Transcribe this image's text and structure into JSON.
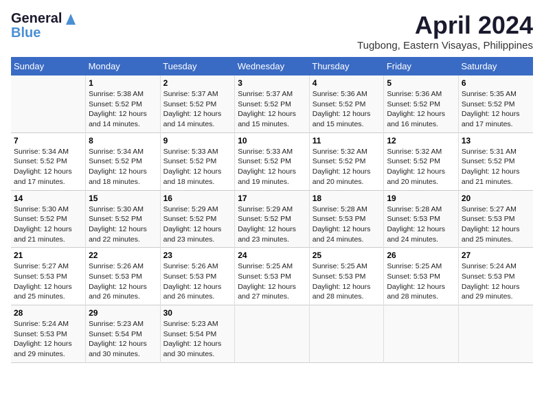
{
  "header": {
    "logo_general": "General",
    "logo_blue": "Blue",
    "month_title": "April 2024",
    "location": "Tugbong, Eastern Visayas, Philippines"
  },
  "days_of_week": [
    "Sunday",
    "Monday",
    "Tuesday",
    "Wednesday",
    "Thursday",
    "Friday",
    "Saturday"
  ],
  "weeks": [
    [
      {
        "day": "",
        "info": ""
      },
      {
        "day": "1",
        "info": "Sunrise: 5:38 AM\nSunset: 5:52 PM\nDaylight: 12 hours and 14 minutes."
      },
      {
        "day": "2",
        "info": "Sunrise: 5:37 AM\nSunset: 5:52 PM\nDaylight: 12 hours and 14 minutes."
      },
      {
        "day": "3",
        "info": "Sunrise: 5:37 AM\nSunset: 5:52 PM\nDaylight: 12 hours and 15 minutes."
      },
      {
        "day": "4",
        "info": "Sunrise: 5:36 AM\nSunset: 5:52 PM\nDaylight: 12 hours and 15 minutes."
      },
      {
        "day": "5",
        "info": "Sunrise: 5:36 AM\nSunset: 5:52 PM\nDaylight: 12 hours and 16 minutes."
      },
      {
        "day": "6",
        "info": "Sunrise: 5:35 AM\nSunset: 5:52 PM\nDaylight: 12 hours and 17 minutes."
      }
    ],
    [
      {
        "day": "7",
        "info": "Sunrise: 5:34 AM\nSunset: 5:52 PM\nDaylight: 12 hours and 17 minutes."
      },
      {
        "day": "8",
        "info": "Sunrise: 5:34 AM\nSunset: 5:52 PM\nDaylight: 12 hours and 18 minutes."
      },
      {
        "day": "9",
        "info": "Sunrise: 5:33 AM\nSunset: 5:52 PM\nDaylight: 12 hours and 18 minutes."
      },
      {
        "day": "10",
        "info": "Sunrise: 5:33 AM\nSunset: 5:52 PM\nDaylight: 12 hours and 19 minutes."
      },
      {
        "day": "11",
        "info": "Sunrise: 5:32 AM\nSunset: 5:52 PM\nDaylight: 12 hours and 20 minutes."
      },
      {
        "day": "12",
        "info": "Sunrise: 5:32 AM\nSunset: 5:52 PM\nDaylight: 12 hours and 20 minutes."
      },
      {
        "day": "13",
        "info": "Sunrise: 5:31 AM\nSunset: 5:52 PM\nDaylight: 12 hours and 21 minutes."
      }
    ],
    [
      {
        "day": "14",
        "info": "Sunrise: 5:30 AM\nSunset: 5:52 PM\nDaylight: 12 hours and 21 minutes."
      },
      {
        "day": "15",
        "info": "Sunrise: 5:30 AM\nSunset: 5:52 PM\nDaylight: 12 hours and 22 minutes."
      },
      {
        "day": "16",
        "info": "Sunrise: 5:29 AM\nSunset: 5:52 PM\nDaylight: 12 hours and 23 minutes."
      },
      {
        "day": "17",
        "info": "Sunrise: 5:29 AM\nSunset: 5:52 PM\nDaylight: 12 hours and 23 minutes."
      },
      {
        "day": "18",
        "info": "Sunrise: 5:28 AM\nSunset: 5:53 PM\nDaylight: 12 hours and 24 minutes."
      },
      {
        "day": "19",
        "info": "Sunrise: 5:28 AM\nSunset: 5:53 PM\nDaylight: 12 hours and 24 minutes."
      },
      {
        "day": "20",
        "info": "Sunrise: 5:27 AM\nSunset: 5:53 PM\nDaylight: 12 hours and 25 minutes."
      }
    ],
    [
      {
        "day": "21",
        "info": "Sunrise: 5:27 AM\nSunset: 5:53 PM\nDaylight: 12 hours and 25 minutes."
      },
      {
        "day": "22",
        "info": "Sunrise: 5:26 AM\nSunset: 5:53 PM\nDaylight: 12 hours and 26 minutes."
      },
      {
        "day": "23",
        "info": "Sunrise: 5:26 AM\nSunset: 5:53 PM\nDaylight: 12 hours and 26 minutes."
      },
      {
        "day": "24",
        "info": "Sunrise: 5:25 AM\nSunset: 5:53 PM\nDaylight: 12 hours and 27 minutes."
      },
      {
        "day": "25",
        "info": "Sunrise: 5:25 AM\nSunset: 5:53 PM\nDaylight: 12 hours and 28 minutes."
      },
      {
        "day": "26",
        "info": "Sunrise: 5:25 AM\nSunset: 5:53 PM\nDaylight: 12 hours and 28 minutes."
      },
      {
        "day": "27",
        "info": "Sunrise: 5:24 AM\nSunset: 5:53 PM\nDaylight: 12 hours and 29 minutes."
      }
    ],
    [
      {
        "day": "28",
        "info": "Sunrise: 5:24 AM\nSunset: 5:53 PM\nDaylight: 12 hours and 29 minutes."
      },
      {
        "day": "29",
        "info": "Sunrise: 5:23 AM\nSunset: 5:54 PM\nDaylight: 12 hours and 30 minutes."
      },
      {
        "day": "30",
        "info": "Sunrise: 5:23 AM\nSunset: 5:54 PM\nDaylight: 12 hours and 30 minutes."
      },
      {
        "day": "",
        "info": ""
      },
      {
        "day": "",
        "info": ""
      },
      {
        "day": "",
        "info": ""
      },
      {
        "day": "",
        "info": ""
      }
    ]
  ]
}
